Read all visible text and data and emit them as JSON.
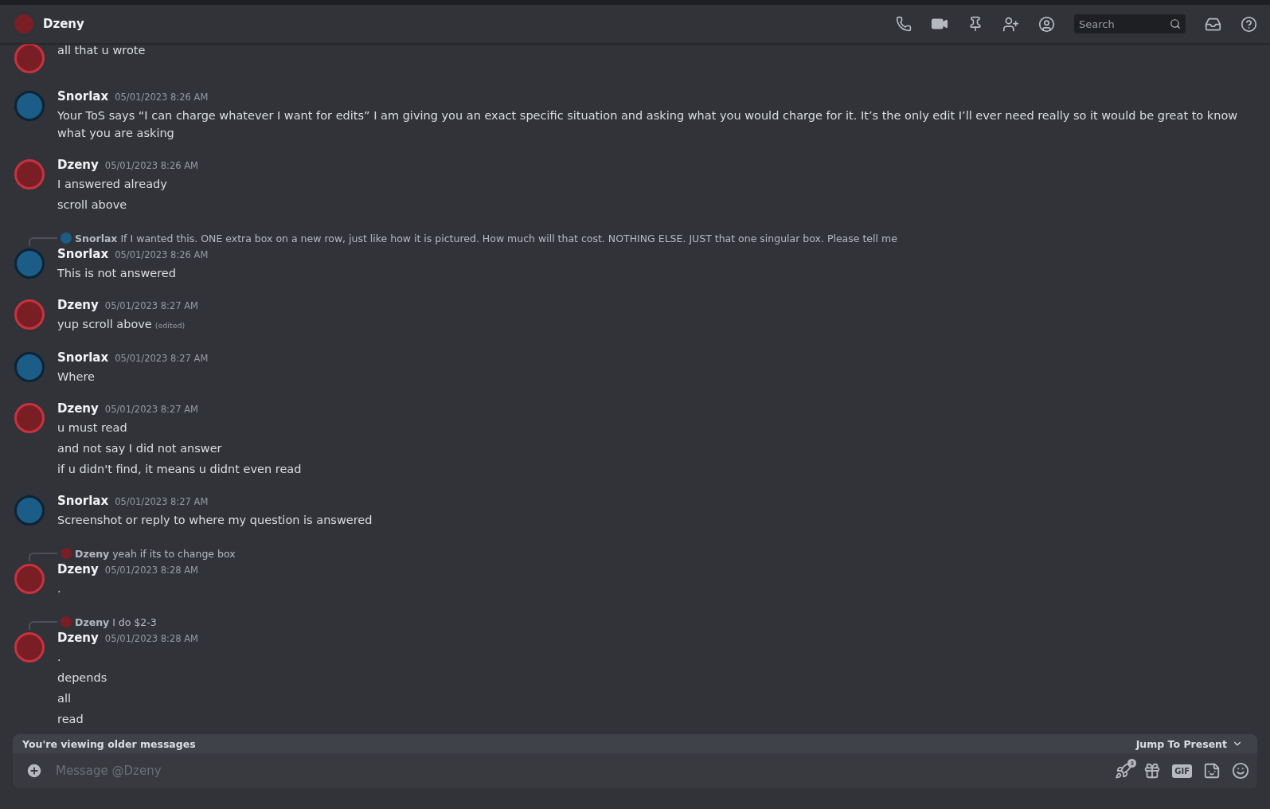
{
  "header": {
    "title": "Dzeny",
    "search": {
      "placeholder": "Search"
    }
  },
  "messages": [
    {
      "kind": "dzeny",
      "lines": [
        {
          "text": "all that u wrote"
        }
      ]
    },
    {
      "kind": "snorlax",
      "author": "Snorlax",
      "timestamp": "05/01/2023 8:26 AM",
      "lines": [
        {
          "text": "Your ToS says “I can charge whatever I want for edits” I am giving you an exact specific situation and asking what you would charge for it. It’s the only edit I’ll ever need really so it would be great to know what you are asking"
        }
      ]
    },
    {
      "kind": "dzeny",
      "author": "Dzeny",
      "timestamp": "05/01/2023 8:26 AM",
      "lines": [
        {
          "text": "I answered already"
        },
        {
          "text": "scroll above"
        }
      ]
    },
    {
      "kind": "snorlax",
      "author": "Snorlax",
      "timestamp": "05/01/2023 8:26 AM",
      "reply": {
        "kind": "snorlax",
        "author": "Snorlax",
        "text": "If I wanted this. ONE extra box on a new row, just like how it is pictured. How much will that cost. NOTHING ELSE. JUST that one singular box. Please tell me"
      },
      "lines": [
        {
          "text": "This is not answered"
        }
      ]
    },
    {
      "kind": "dzeny",
      "author": "Dzeny",
      "timestamp": "05/01/2023 8:27 AM",
      "lines": [
        {
          "text": "yup scroll above",
          "edited": "(edited)"
        }
      ]
    },
    {
      "kind": "snorlax",
      "author": "Snorlax",
      "timestamp": "05/01/2023 8:27 AM",
      "lines": [
        {
          "text": "Where"
        }
      ]
    },
    {
      "kind": "dzeny",
      "author": "Dzeny",
      "timestamp": "05/01/2023 8:27 AM",
      "lines": [
        {
          "text": "u must read"
        },
        {
          "text": "and not say I did not answer"
        },
        {
          "text": "if u didn't find, it means u didnt even read"
        }
      ]
    },
    {
      "kind": "snorlax",
      "author": "Snorlax",
      "timestamp": "05/01/2023 8:27 AM",
      "lines": [
        {
          "text": "Screenshot or reply to where my question is answered"
        }
      ]
    },
    {
      "kind": "dzeny",
      "author": "Dzeny",
      "timestamp": "05/01/2023 8:28 AM",
      "reply": {
        "kind": "dzeny",
        "author": "Dzeny",
        "text": "yeah if its to change box"
      },
      "lines": [
        {
          "text": "."
        }
      ]
    },
    {
      "kind": "dzeny",
      "author": "Dzeny",
      "timestamp": "05/01/2023 8:28 AM",
      "reply": {
        "kind": "dzeny",
        "author": "Dzeny",
        "text": "I do $2-3"
      },
      "lines": [
        {
          "text": "."
        },
        {
          "text": "depends"
        },
        {
          "text": "all"
        },
        {
          "text": "read"
        }
      ]
    }
  ],
  "older_bar": {
    "text": "You're viewing older messages",
    "action": "Jump To Present"
  },
  "composer": {
    "placeholder": "Message @Dzeny",
    "boost_badge": "3",
    "gif": "GIF"
  }
}
